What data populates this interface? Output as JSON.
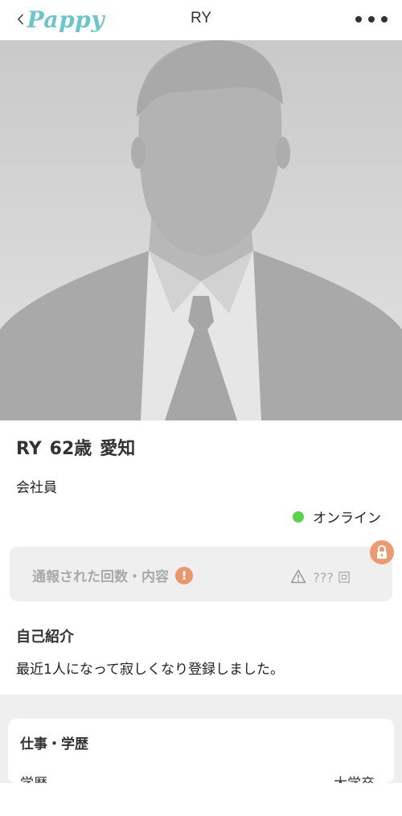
{
  "header": {
    "back_icon": "chevron-left-icon",
    "logo_text": "Pappy",
    "title": "RY",
    "more_icon": "ellipsis-icon"
  },
  "photo": {
    "alt": "silhouette-avatar"
  },
  "profile": {
    "name": "RY",
    "age": "62歳",
    "location": "愛知",
    "occupation": "会社員",
    "status": "オンライン"
  },
  "report": {
    "label": "通報された回数・内容",
    "count": "??? 回"
  },
  "intro": {
    "title": "自己紹介",
    "text": "最近1人になって寂しくなり登録しました。"
  },
  "work": {
    "title": "仕事・学歴",
    "education_label": "学歴",
    "education_value": "大学卒"
  },
  "colors": {
    "accent": "#6cc5c7",
    "online": "#5bd24b",
    "warning": "#e9966b",
    "lock": "#eb9a73"
  }
}
